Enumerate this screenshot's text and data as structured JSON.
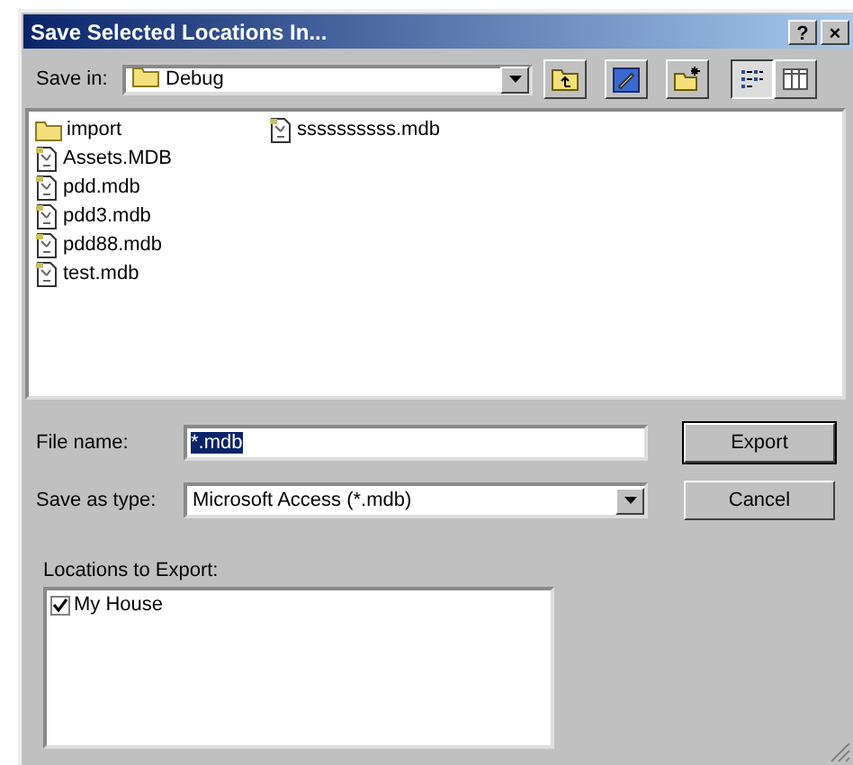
{
  "window": {
    "title": "Save Selected Locations In...",
    "help_button": "?",
    "close_button": "×"
  },
  "save_in": {
    "label": "Save in:",
    "value": "Debug"
  },
  "toolbar": [
    {
      "kind": "up-folder",
      "pressed": false
    },
    {
      "kind": "desktop",
      "pressed": false
    },
    {
      "kind": "new-folder",
      "pressed": false
    },
    {
      "kind": "list-view",
      "pressed": true
    },
    {
      "kind": "details-view",
      "pressed": false
    }
  ],
  "files": [
    {
      "name": "import",
      "kind": "folder"
    },
    {
      "name": "Assets.MDB",
      "kind": "database"
    },
    {
      "name": "pdd.mdb",
      "kind": "database"
    },
    {
      "name": "pdd3.mdb",
      "kind": "database"
    },
    {
      "name": "pdd88.mdb",
      "kind": "database"
    },
    {
      "name": "test.mdb",
      "kind": "database"
    },
    {
      "name": "ssssssssss.mdb",
      "kind": "database"
    }
  ],
  "file_name": {
    "label": "File name:",
    "value": "*.mdb",
    "selected": true
  },
  "save_as_type": {
    "label": "Save as type:",
    "value": "Microsoft Access (*.mdb)"
  },
  "buttons": [
    {
      "label": "Export",
      "default": true
    },
    {
      "label": "Cancel",
      "default": false
    }
  ],
  "locations": {
    "label": "Locations to Export:",
    "items": [
      {
        "label": "My House",
        "checked": true
      }
    ]
  }
}
